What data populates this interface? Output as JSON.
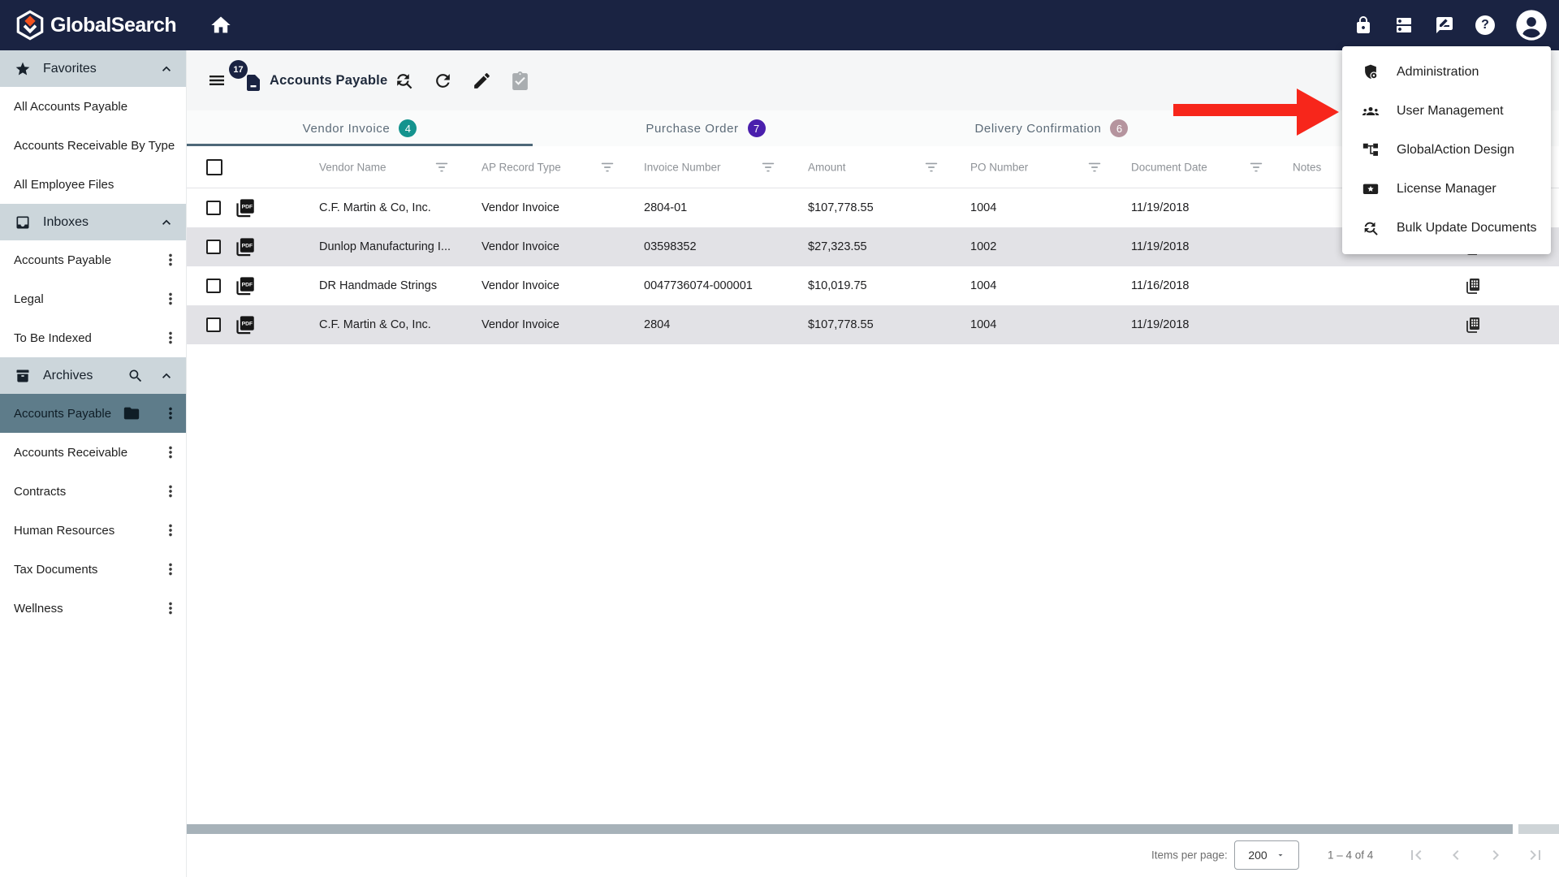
{
  "topbar": {
    "brand": "GlobalSearch",
    "help_glyph": "?"
  },
  "sidebar": {
    "favorites": {
      "label": "Favorites",
      "items": [
        "All Accounts Payable",
        "Accounts Receivable By Type",
        "All Employee Files"
      ]
    },
    "inboxes": {
      "label": "Inboxes",
      "items": [
        "Accounts Payable",
        "Legal",
        "To Be Indexed"
      ]
    },
    "archives": {
      "label": "Archives",
      "selected_item": "Accounts Payable",
      "items": [
        "Accounts Receivable",
        "Contracts",
        "Human Resources",
        "Tax Documents",
        "Wellness"
      ]
    }
  },
  "toolbar": {
    "title": "Accounts Payable",
    "doc_count_badge": "17"
  },
  "tabs": [
    {
      "label": "Vendor Invoice",
      "count": "4",
      "badge_color": "#14938e",
      "active": true
    },
    {
      "label": "Purchase Order",
      "count": "7",
      "badge_color": "#4a1fad",
      "active": false
    },
    {
      "label": "Delivery Confirmation",
      "count": "6",
      "badge_color": "#b5949e",
      "active": false
    }
  ],
  "table": {
    "headers": [
      "Vendor Name",
      "AP Record Type",
      "Invoice Number",
      "Amount",
      "PO Number",
      "Document Date",
      "Notes"
    ],
    "rows": [
      {
        "vendor": "C.F. Martin & Co, Inc.",
        "type": "Vendor Invoice",
        "invoice": "2804-01",
        "amount": "$107,778.55",
        "po": "1004",
        "date": "11/19/2018",
        "has_table_icon": false
      },
      {
        "vendor": "Dunlop Manufacturing I...",
        "type": "Vendor Invoice",
        "invoice": "03598352",
        "amount": "$27,323.55",
        "po": "1002",
        "date": "11/19/2018",
        "has_table_icon": true
      },
      {
        "vendor": "DR Handmade Strings",
        "type": "Vendor Invoice",
        "invoice": "0047736074-000001",
        "amount": "$10,019.75",
        "po": "1004",
        "date": "11/16/2018",
        "has_table_icon": true
      },
      {
        "vendor": "C.F. Martin & Co, Inc.",
        "type": "Vendor Invoice",
        "invoice": "2804",
        "amount": "$107,778.55",
        "po": "1004",
        "date": "11/19/2018",
        "has_table_icon": true
      }
    ]
  },
  "admin_menu": {
    "items": [
      {
        "label": "Administration"
      },
      {
        "label": "User Management"
      },
      {
        "label": "GlobalAction Design"
      },
      {
        "label": "License Manager"
      },
      {
        "label": "Bulk Update Documents"
      }
    ]
  },
  "pagination": {
    "items_per_page_label": "Items per page:",
    "page_size": "200",
    "range_label": "1 – 4 of 4"
  },
  "colors": {
    "topbar_bg": "#1a2342",
    "annotation_red": "#f7261b",
    "active_tab_underline": "#4d6878",
    "row_shaded_bg": "#e2e2e6",
    "sidebar_header_bg": "#ccd6db",
    "sidebar_selected_bg": "#5e7c8a",
    "scrollbar_thumb": "#a7b2b9"
  }
}
